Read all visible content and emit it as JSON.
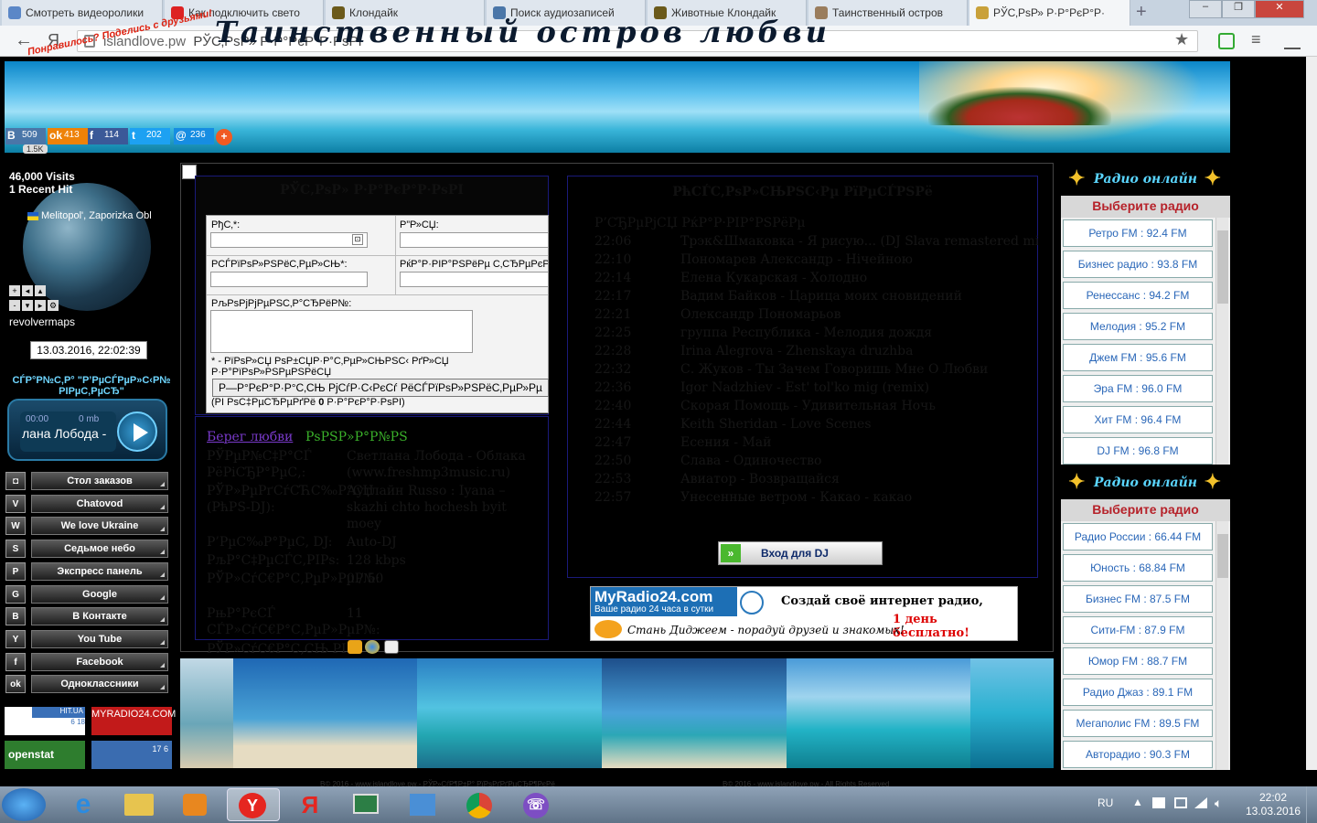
{
  "browser": {
    "tabs": [
      {
        "label": "Смотреть видеоролики",
        "color": "#5b87c7"
      },
      {
        "label": "Как подключить свето",
        "color": "#d22"
      },
      {
        "label": "Клондайк",
        "color": "#6b5a1b"
      },
      {
        "label": "Поиск аудиозаписей",
        "color": "#4a76a8"
      },
      {
        "label": "Животные Клондайк",
        "color": "#6b5a1b"
      },
      {
        "label": "Таинственный остров",
        "color": "#9a7d5d"
      },
      {
        "label": "РЎС‚РѕР» Р·Р°РєР°Р·",
        "color": "#c9a13a"
      }
    ],
    "new_tab": "+",
    "back": "←",
    "yandex": "Я",
    "domain": "islandlove.pw",
    "page_title": "РЎС‚РѕР» Р·Р°РєР°Р·РѕРІ",
    "star": "★",
    "window_controls": [
      "–",
      "❐",
      "✕"
    ],
    "menu_icon": "≡"
  },
  "banner": {
    "title": "Таинственный остров любви",
    "share_hint": "Понравилось? Поделись с друзьями!",
    "shares": [
      {
        "net": "В",
        "count": "509",
        "color": "#4a76a8"
      },
      {
        "net": "ok",
        "count": "413",
        "color": "#ee8208"
      },
      {
        "net": "f",
        "count": "114",
        "color": "#3b5998"
      },
      {
        "net": "t",
        "count": "202",
        "color": "#1da1f2"
      },
      {
        "net": "@",
        "count": "236",
        "color": "#168de2"
      }
    ],
    "plus": "+",
    "total": "1.5K"
  },
  "left": {
    "visits": "46,000 Visits",
    "recent": "1 Recent Hit",
    "location": "Melitopol', Zaporizka Obl",
    "revolvermaps": "revolvermaps",
    "clock": "13.03.2016, 22:02:39",
    "player_title": "СЃР°Р№С‚Р° \"Р’РµСЃРµР»С‹Р№ РІРµС‚РµСЂ\"",
    "player_time": "00:00",
    "player_size": "0 mb",
    "player_song": "лана Лобода -",
    "nav": [
      {
        "icon": "◘",
        "label": "Стол заказов"
      },
      {
        "icon": "V",
        "label": "Chatovod"
      },
      {
        "icon": "W",
        "label": "We love Ukraine"
      },
      {
        "icon": "S",
        "label": "Седьмое небо"
      },
      {
        "icon": "P",
        "label": "Экспресс панель"
      },
      {
        "icon": "G",
        "label": "Google"
      },
      {
        "icon": "B",
        "label": "В Контакте"
      },
      {
        "icon": "Y",
        "label": "You Tube"
      },
      {
        "icon": "f",
        "label": "Facebook"
      },
      {
        "icon": "ok",
        "label": "Одноклассники"
      }
    ],
    "counters": {
      "hitua": "HIT.UA",
      "hitua_nums": "6 18",
      "myradio": "MYRADIO24.COM",
      "openstat": "openstat",
      "c4": "17 6"
    }
  },
  "form": {
    "title": "РЎС‚РѕР» Р·Р°РєР°Р·РѕРІ",
    "name_label": "РђС‚*:",
    "to_label": "Р”Р»СЏ:",
    "song_label": "РСЃРїРѕР»РЅРёС‚РµР»СЊ*:",
    "comp_label": "РќР°Р·РІР°РЅРёРµ С‚СЂРµРєР°*:",
    "comment_label": "РљРѕРјРјРµРЅС‚Р°СЂРёР№:",
    "required_note": "* - РїРѕР»СЏ РѕР±СЏР·Р°С‚РµР»СЊРЅС‹ РґР»СЏ Р·Р°РїРѕР»РЅРµРЅРёСЏ",
    "send": "Р—Р°РєР°Р·Р°С‚СЊ РјСѓР·С‹РєСѓ РёСЃРїРѕР»РЅРёС‚РµР»Рµ",
    "chars_prefix": "(РІ РѕС‡РµСЂРµРґРё",
    "chars_num": "0",
    "chars_suffix": "Р·Р°РєР°Р·РѕРІ)"
  },
  "info": {
    "shore": "Берег любви",
    "live": "РѕРЅР»Р°Р№РЅ",
    "dash": " - ",
    "rows": [
      {
        "k": "РЎРµР№С‡Р°СЃ РёРіСЂР°РµС‚:",
        "v": "Светлана Лобода - Облака (www.freshmp3music.ru)"
      },
      {
        "k": "РЎР»РµРґСѓСЋС‰Р°СЏ (РћРЅ-DJ):",
        "v": "Аутлайн Russo : Iyana – skazhi chto hochesh byit moey"
      },
      {
        "k": "Р’РµС‰Р°РµС‚ DJ:",
        "v": "Auto-DJ"
      },
      {
        "k": "РљР°С‡РµСЃС‚РІРѕ:",
        "v": "128 kbps"
      },
      {
        "k": "РЎР»СѓС€Р°С‚РµР»РµР№:",
        "v": "0 / 50"
      },
      {
        "k": "РњР°РєСЃ СЃР»СѓС€Р°С‚РµР»РµР№:",
        "v": "11"
      }
    ],
    "bottom_label": "РЎР»СѓС€Р°С‚СЊ РІ:"
  },
  "history": {
    "title": "РћСЃС‚РѕР»СЊРЅС‹Рµ РїРµСЃРЅРё",
    "head": "Р’СЂРµРјСЏ  РќР°Р·РІР°РЅРёРµ",
    "rows": [
      {
        "t": "22:06",
        "tr": "Трэк&Шмаковка - Я рисую... (DJ Slava remastered mix)"
      },
      {
        "t": "22:10",
        "tr": "Пономарев Александр - Нічейною"
      },
      {
        "t": "22:14",
        "tr": "Елена Кукарская - Холодно"
      },
      {
        "t": "22:17",
        "tr": "Вадим Байков - Царица моих сновидений"
      },
      {
        "t": "22:21",
        "tr": "Олександр Пономарьов"
      },
      {
        "t": "22:25",
        "tr": "группа Республика - Мелодия дождя"
      },
      {
        "t": "22:28",
        "tr": "Irina Alegrova - Zhenskaya druzhba"
      },
      {
        "t": "22:32",
        "tr": "С. Жуков - Ты Зачем Говоришь Мне О Любви"
      },
      {
        "t": "22:36",
        "tr": "Igor Nadzhiev - Est' tol'ko mig (remix)"
      },
      {
        "t": "22:40",
        "tr": "Скорая Помощь - Удивительная Ночь"
      },
      {
        "t": "22:44",
        "tr": "Keith Sheridan - Love Scenes"
      },
      {
        "t": "22:47",
        "tr": "Есения - Май"
      },
      {
        "t": "22:50",
        "tr": "Слава - Одиночество"
      },
      {
        "t": "22:53",
        "tr": "Авиатор - Возвращайся"
      },
      {
        "t": "22:57",
        "tr": "Унесенные ветром - Какао - какао"
      }
    ],
    "dj_button": "Вход для  DJ",
    "dj_icon": "»"
  },
  "ad": {
    "logo": "MyRadio24.com",
    "logo_sub": "Ваше радио 24 часа в сутки",
    "line1": "Создай своё интернет радио,",
    "line2": "1 день бесплатно!",
    "line3": "Стань Диджеем - порадуй друзей и знакомых!"
  },
  "radio1": {
    "title": "Радио онлайн",
    "select": "Выберите радио",
    "stations": [
      "Ретро FM : 92.4 FM",
      "Бизнес радио : 93.8 FM",
      "Ренессанс : 94.2 FM",
      "Мелодия : 95.2 FM",
      "Джем FM : 95.6 FM",
      "Эра FM : 96.0 FM",
      "Хит FM : 96.4 FM",
      "DJ FM : 96.8 FM"
    ]
  },
  "radio2": {
    "title": "Радио онлайн",
    "select": "Выберите радио",
    "stations": [
      "Радио России : 66.44 FM",
      "Юность : 68.84 FM",
      "Бизнес FM : 87.5 FM",
      "Сити-FM : 87.9 FM",
      "Юмор FM : 88.7 FM",
      "Радио Джаз : 89.1 FM",
      "Мегаполис FM : 89.5 FM",
      "Авторадио : 90.3 FM"
    ]
  },
  "footer": {
    "left": "В© 2016 - www.islandlove.pw - РЎР»СѓР¶Р±Р° РїРѕРґРґРµСЂР¶РєРё",
    "right": "В© 2016 - www.islandlove.pw - All Rights Reserved"
  },
  "taskbar": {
    "lang": "RU",
    "time": "22:02",
    "date": "13.03.2016",
    "apps": [
      "start",
      "internet-explorer",
      "file-explorer",
      "media-player",
      "yandex",
      "yandex-browser",
      "desktop",
      "control-panel",
      "chrome",
      "viber"
    ],
    "ie_glyph": "e",
    "y_glyph": "Y",
    "ya_glyph": "Я",
    "viber_glyph": "☏"
  }
}
